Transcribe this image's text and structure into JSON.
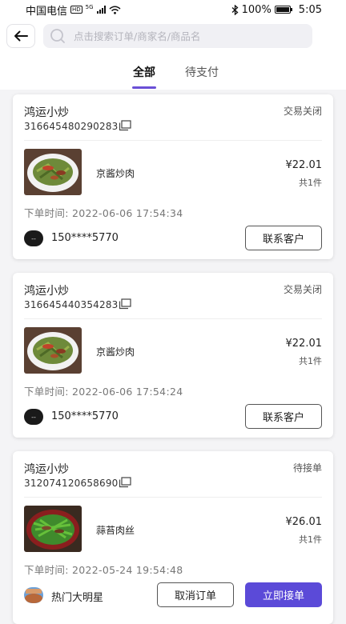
{
  "status_bar": {
    "carrier": "中国电信",
    "hd": "HD",
    "network": "5G",
    "battery": "100%",
    "time": "5:05"
  },
  "search": {
    "placeholder": "点击搜索订单/商家名/商品名"
  },
  "tabs": [
    {
      "label": "全部",
      "active": true
    },
    {
      "label": "待支付",
      "active": false
    }
  ],
  "orders": [
    {
      "shop": "鸿运小炒",
      "status": "交易关闭",
      "order_no": "316645480290283",
      "item": "京酱炒肉",
      "price": "¥22.01",
      "qty": "共1件",
      "time_label": "下单时间:",
      "time": "2022-06-06 17:54:34",
      "contact": "150****5770",
      "buttons": [
        "联系客户"
      ]
    },
    {
      "shop": "鸿运小炒",
      "status": "交易关闭",
      "order_no": "316645440354283",
      "item": "京酱炒肉",
      "price": "¥22.01",
      "qty": "共1件",
      "time_label": "下单时间:",
      "time": "2022-06-06 17:54:24",
      "contact": "150****5770",
      "buttons": [
        "联系客户"
      ]
    },
    {
      "shop": "鸿运小炒",
      "status": "待接单",
      "order_no": "312074120658690",
      "item": "蒜苔肉丝",
      "price": "¥26.01",
      "qty": "共1件",
      "time_label": "下单时间:",
      "time": "2022-05-24 19:54:48",
      "contact": "热门大明星",
      "buttons": [
        "取消订单",
        "立即接单"
      ]
    }
  ],
  "colors": {
    "accent": "#5b4ad8",
    "tab_underline": "#6a4fd6"
  }
}
